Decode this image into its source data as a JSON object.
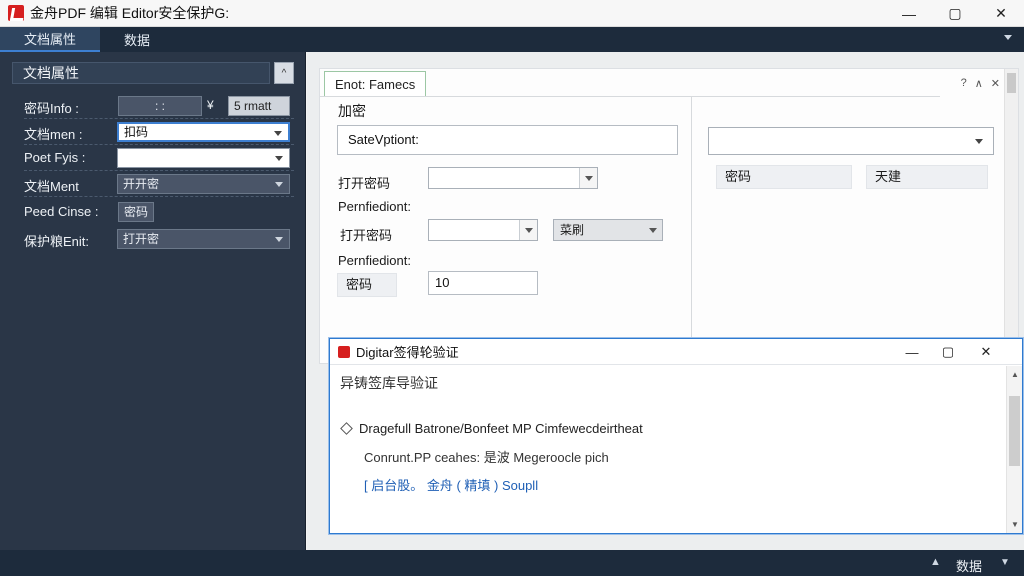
{
  "window": {
    "title": "金舟PDF 编辑 Editor安全保护G:",
    "minimize": "—",
    "maximize": "▢",
    "close": "✕"
  },
  "tabs": [
    {
      "label": "文档属性",
      "active": true
    },
    {
      "label": "数据",
      "active": false
    }
  ],
  "left_panel": {
    "header": "文档属性",
    "collapse_glyph": "^",
    "rows": [
      {
        "label": "密码Info :",
        "value": ": :",
        "extra_label": "¥",
        "extra_value": "5 rmatt"
      },
      {
        "label": "文档men :",
        "value": "扣码"
      },
      {
        "label": "Poet Fyis :",
        "value": ""
      },
      {
        "label": "文档Ment",
        "value": "开开密"
      },
      {
        "label": "Peed Cinse :",
        "value": "密码"
      },
      {
        "label": "保护粮Enit:",
        "value": "打开密"
      }
    ]
  },
  "settings": {
    "tab_label": "Enot: Famecs",
    "icons": [
      "?",
      "∧",
      "✕"
    ],
    "section_title": "加密",
    "save_option": "SateVptiont:",
    "right_select": "",
    "open_password_label": "打开密码",
    "open_password_value": "",
    "permission_label_1": "Pernfiediont:",
    "open_password_label_2": "打开密码",
    "open_password_value_2": "",
    "permission_select": "菜刷",
    "permission_label_2": "Pernfiediont:",
    "password_button": "密码",
    "password_number": "10",
    "right_password_label": "密码",
    "right_action_label": "天建"
  },
  "signature_dialog": {
    "title": "Digitar签得轮验证",
    "subtitle": "异铸签库导验证",
    "line1": "Dragefull Batrone/Bonfeet MP Cimfewecdeirtheat",
    "line2": "Conrunt.PP ceahes: 是波 Megeroocle pich",
    "line3": "[ 启台股。 金舟 ( 精填 ) Soupll",
    "minimize": "—",
    "maximize": "▢",
    "close": "✕"
  },
  "status_bar": {
    "arrow": "▲",
    "text": "数据"
  },
  "colors": {
    "titlebar": "#f7f7f7",
    "navy": "#1d2b3c",
    "left_panel": "#2a3647",
    "accent": "#3d7fd1",
    "brand_red": "#d61f1f"
  }
}
